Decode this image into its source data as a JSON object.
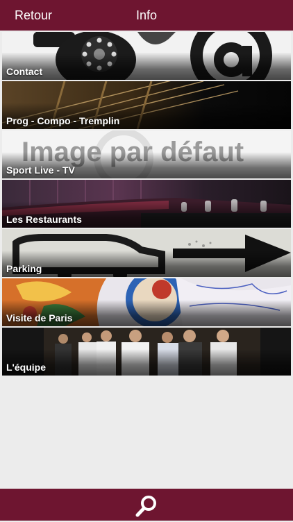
{
  "header": {
    "back_label": "Retour",
    "title": "Info"
  },
  "items": [
    {
      "label": "Contact",
      "image": "telephone-and-at-sign"
    },
    {
      "label": "Prog - Compo - Tremplin",
      "image": "guitar-strings"
    },
    {
      "label": "Sport Live - TV",
      "image": "default-placeholder",
      "placeholder_text": "Image par défaut"
    },
    {
      "label": "Les Restaurants",
      "image": "restaurant-interior"
    },
    {
      "label": "Parking",
      "image": "car-and-arrow"
    },
    {
      "label": "Visite de Paris",
      "image": "colorful-sculpture"
    },
    {
      "label": "L'équipe",
      "image": "team-photo"
    }
  ],
  "footer": {
    "search_icon": "magnifier-icon"
  },
  "colors": {
    "bar": "#6e1530",
    "background": "#ececec"
  }
}
